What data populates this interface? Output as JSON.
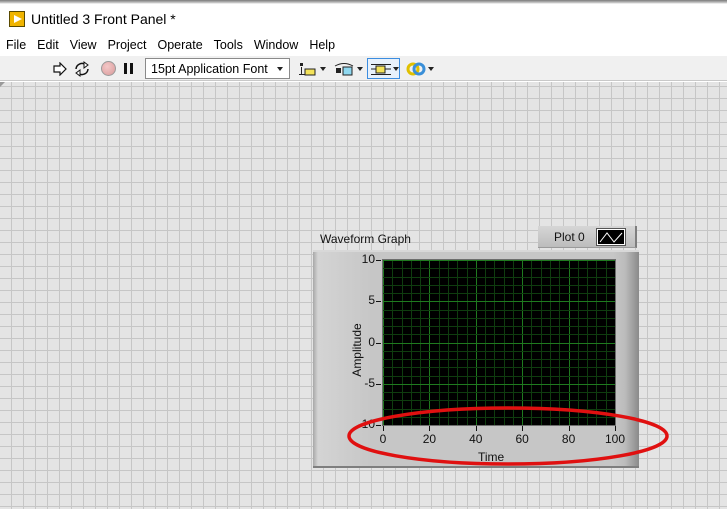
{
  "window": {
    "title": "Untitled 3 Front Panel *",
    "app_icon": "labview-icon"
  },
  "menubar": {
    "items": [
      "File",
      "Edit",
      "View",
      "Project",
      "Operate",
      "Tools",
      "Window",
      "Help"
    ]
  },
  "toolbar": {
    "run_icon": "run-arrow-icon",
    "run_continuously_icon": "run-continuously-icon",
    "abort_icon": "abort-execution-icon",
    "pause_icon": "pause-icon",
    "font_selector": "15pt Application Font",
    "align_icon": "align-objects-icon",
    "distribute_icon": "distribute-objects-icon",
    "resize_icon": "resize-objects-icon",
    "reorder_icon": "reorder-icon"
  },
  "graph": {
    "label": "Waveform Graph",
    "legend": {
      "plot_name": "Plot 0"
    },
    "colors": {
      "plot_bg": "#000000",
      "grid_major": "#1f7a1f",
      "grid_minor": "#0f3d0f",
      "annotation": "#e01010"
    }
  },
  "chart_data": {
    "type": "line",
    "title": "Waveform Graph",
    "xlabel": "Time",
    "ylabel": "Amplitude",
    "xlim": [
      0,
      100
    ],
    "ylim": [
      -10,
      10
    ],
    "xticks": [
      "0",
      "20",
      "40",
      "60",
      "80",
      "100"
    ],
    "yticks": [
      "10",
      "5",
      "0",
      "-5",
      "-10"
    ],
    "x_major_step": 20,
    "x_minor_divisions": 5,
    "y_major_step": 5,
    "y_minor_divisions": 5,
    "grid": true,
    "legend": {
      "entries": [
        "Plot 0"
      ],
      "placement": "top-right"
    },
    "series": [
      {
        "name": "Plot 0",
        "values": []
      }
    ],
    "annotation": "red ellipse highlighting x-axis scale and Time label"
  }
}
